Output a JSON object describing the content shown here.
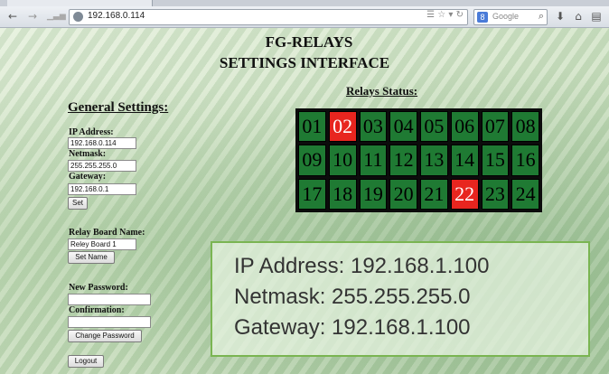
{
  "browser": {
    "url": "192.168.0.114",
    "search_placeholder": "Google",
    "search_engine_letter": "8"
  },
  "page": {
    "title_line1": "FG-RELAYS",
    "title_line2": "SETTINGS INTERFACE"
  },
  "general": {
    "heading": "General Settings:",
    "ip_label": "IP Address:",
    "ip_value": "192.168.0.114",
    "netmask_label": "Netmask:",
    "netmask_value": "255.255.255.0",
    "gateway_label": "Gateway:",
    "gateway_value": "192.168.0.1",
    "set_label": "Set",
    "board_name_label": "Relay Board Name:",
    "board_name_value": "Reley Board 1",
    "set_name_label": "Set Name",
    "new_password_label": "New Password:",
    "confirmation_label": "Confirmation:",
    "change_password_label": "Change Password",
    "logout_label": "Logout"
  },
  "relays": {
    "heading": "Relays Status:",
    "labels": [
      "01",
      "02",
      "03",
      "04",
      "05",
      "06",
      "07",
      "08",
      "09",
      "10",
      "11",
      "12",
      "13",
      "14",
      "15",
      "16",
      "17",
      "18",
      "19",
      "20",
      "21",
      "22",
      "23",
      "24"
    ],
    "active": [
      2,
      22
    ],
    "on_color": "#e8251f",
    "off_color": "#1f7a33"
  },
  "overlay": {
    "line1": "IP Address: 192.168.1.100",
    "line2": "Netmask: 255.255.255.0",
    "line3": "Gateway: 192.168.1.100",
    "border_color": "#7ab552"
  }
}
